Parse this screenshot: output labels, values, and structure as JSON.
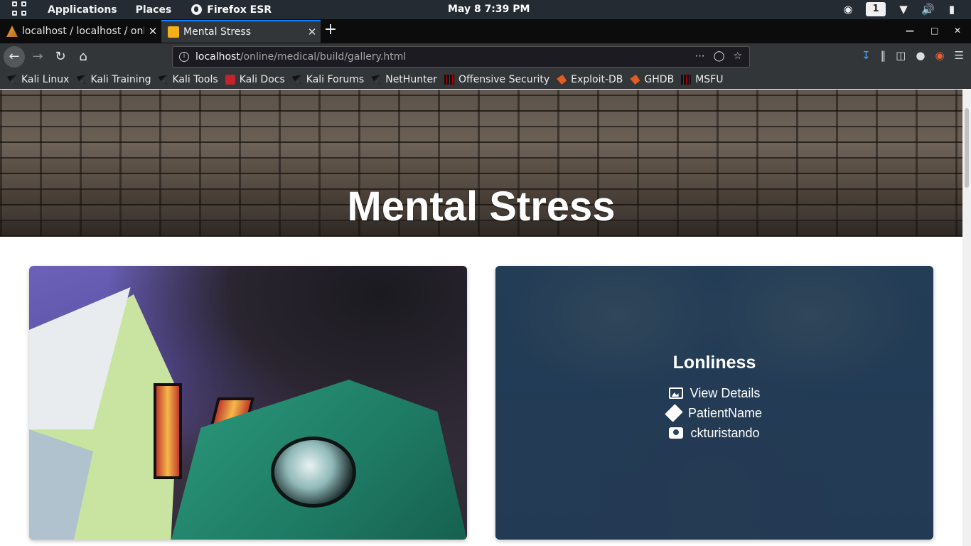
{
  "system_panel": {
    "applications_label": "Applications",
    "places_label": "Places",
    "active_app_label": "Firefox ESR",
    "clock": "May 8   7:39 PM",
    "workspace": "1"
  },
  "tabs": [
    {
      "label": "localhost / localhost / online",
      "active": false
    },
    {
      "label": "Mental Stress",
      "active": true
    }
  ],
  "navbar": {
    "url_host": "localhost",
    "url_path": "/online/medical/build/gallery.html"
  },
  "bookmarks": [
    {
      "label": "Kali Linux",
      "icon": "kali-dragon-icon"
    },
    {
      "label": "Kali Training",
      "icon": "kali-dragon-icon"
    },
    {
      "label": "Kali Tools",
      "icon": "kali-dragon-icon"
    },
    {
      "label": "Kali Docs",
      "icon": "kali-docs-icon"
    },
    {
      "label": "Kali Forums",
      "icon": "kali-dragon-icon"
    },
    {
      "label": "NetHunter",
      "icon": "nethunter-icon"
    },
    {
      "label": "Offensive Security",
      "icon": "offsec-icon"
    },
    {
      "label": "Exploit-DB",
      "icon": "exploit-db-icon"
    },
    {
      "label": "GHDB",
      "icon": "exploit-db-icon"
    },
    {
      "label": "MSFU",
      "icon": "offsec-icon"
    }
  ],
  "page": {
    "hero_title": "Mental Stress",
    "cards": [
      {
        "title": "Lonliness",
        "details_label": "View Details",
        "patient_label": "PatientName",
        "author_label": "ckturistando"
      }
    ]
  },
  "colors": {
    "panel_bg": "#242b33",
    "toolbar_bg": "#323639",
    "tab_accent": "#0a84ff",
    "card_overlay": "#203752"
  }
}
